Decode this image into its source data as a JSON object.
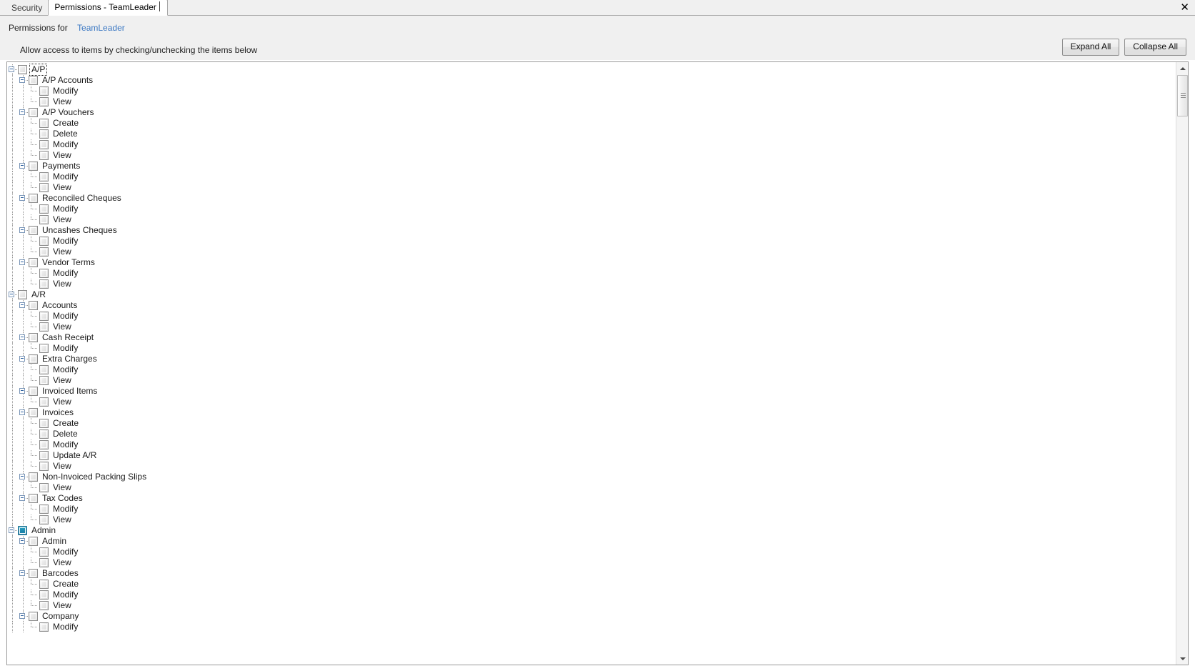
{
  "window": {
    "close_label": "✕"
  },
  "tabs": [
    {
      "label": "Security",
      "active": false
    },
    {
      "label": "Permissions - TeamLeader",
      "active": true
    }
  ],
  "header": {
    "permissions_for_label": "Permissions for",
    "role_name": "TeamLeader",
    "instruction": "Allow access to items by checking/unchecking the items below",
    "expand_all_label": "Expand All",
    "collapse_all_label": "Collapse All"
  },
  "colors": {
    "link": "#3b78c3",
    "checkbox_hot": "#1d87ad",
    "panel_bg": "#f0f0f0",
    "tree_bg": "#ffffff"
  },
  "scrollbar": {
    "up_icon": "triangle-up-icon",
    "down_icon": "triangle-down-icon",
    "thumb_icon": "scroll-thumb"
  },
  "tree": {
    "nodes": [
      {
        "label": "A/P",
        "depth": 0,
        "expander": true,
        "checkbox": "unchecked",
        "focused": true
      },
      {
        "label": "A/P Accounts",
        "depth": 1,
        "expander": true,
        "checkbox": "unchecked"
      },
      {
        "label": "Modify",
        "depth": 2,
        "expander": false,
        "checkbox": "unchecked"
      },
      {
        "label": "View",
        "depth": 2,
        "expander": false,
        "checkbox": "unchecked",
        "last": true
      },
      {
        "label": "A/P Vouchers",
        "depth": 1,
        "expander": true,
        "checkbox": "unchecked"
      },
      {
        "label": "Create",
        "depth": 2,
        "expander": false,
        "checkbox": "unchecked"
      },
      {
        "label": "Delete",
        "depth": 2,
        "expander": false,
        "checkbox": "unchecked"
      },
      {
        "label": "Modify",
        "depth": 2,
        "expander": false,
        "checkbox": "unchecked"
      },
      {
        "label": "View",
        "depth": 2,
        "expander": false,
        "checkbox": "unchecked",
        "last": true
      },
      {
        "label": "Payments",
        "depth": 1,
        "expander": true,
        "checkbox": "unchecked"
      },
      {
        "label": "Modify",
        "depth": 2,
        "expander": false,
        "checkbox": "unchecked"
      },
      {
        "label": "View",
        "depth": 2,
        "expander": false,
        "checkbox": "unchecked",
        "last": true
      },
      {
        "label": "Reconciled Cheques",
        "depth": 1,
        "expander": true,
        "checkbox": "unchecked"
      },
      {
        "label": "Modify",
        "depth": 2,
        "expander": false,
        "checkbox": "unchecked"
      },
      {
        "label": "View",
        "depth": 2,
        "expander": false,
        "checkbox": "unchecked",
        "last": true
      },
      {
        "label": "Uncashes Cheques",
        "depth": 1,
        "expander": true,
        "checkbox": "unchecked"
      },
      {
        "label": "Modify",
        "depth": 2,
        "expander": false,
        "checkbox": "unchecked"
      },
      {
        "label": "View",
        "depth": 2,
        "expander": false,
        "checkbox": "unchecked",
        "last": true
      },
      {
        "label": "Vendor Terms",
        "depth": 1,
        "expander": true,
        "checkbox": "unchecked",
        "last": true
      },
      {
        "label": "Modify",
        "depth": 2,
        "expander": false,
        "checkbox": "unchecked"
      },
      {
        "label": "View",
        "depth": 2,
        "expander": false,
        "checkbox": "unchecked",
        "last": true
      },
      {
        "label": "A/R",
        "depth": 0,
        "expander": true,
        "checkbox": "unchecked"
      },
      {
        "label": "Accounts",
        "depth": 1,
        "expander": true,
        "checkbox": "unchecked"
      },
      {
        "label": "Modify",
        "depth": 2,
        "expander": false,
        "checkbox": "unchecked"
      },
      {
        "label": "View",
        "depth": 2,
        "expander": false,
        "checkbox": "unchecked",
        "last": true
      },
      {
        "label": "Cash Receipt",
        "depth": 1,
        "expander": true,
        "checkbox": "unchecked"
      },
      {
        "label": "Modify",
        "depth": 2,
        "expander": false,
        "checkbox": "unchecked",
        "last": true
      },
      {
        "label": "Extra Charges",
        "depth": 1,
        "expander": true,
        "checkbox": "unchecked"
      },
      {
        "label": "Modify",
        "depth": 2,
        "expander": false,
        "checkbox": "unchecked"
      },
      {
        "label": "View",
        "depth": 2,
        "expander": false,
        "checkbox": "unchecked",
        "last": true
      },
      {
        "label": "Invoiced Items",
        "depth": 1,
        "expander": true,
        "checkbox": "unchecked"
      },
      {
        "label": "View",
        "depth": 2,
        "expander": false,
        "checkbox": "unchecked",
        "last": true
      },
      {
        "label": "Invoices",
        "depth": 1,
        "expander": true,
        "checkbox": "unchecked"
      },
      {
        "label": "Create",
        "depth": 2,
        "expander": false,
        "checkbox": "unchecked"
      },
      {
        "label": "Delete",
        "depth": 2,
        "expander": false,
        "checkbox": "unchecked"
      },
      {
        "label": "Modify",
        "depth": 2,
        "expander": false,
        "checkbox": "unchecked"
      },
      {
        "label": "Update A/R",
        "depth": 2,
        "expander": false,
        "checkbox": "unchecked"
      },
      {
        "label": "View",
        "depth": 2,
        "expander": false,
        "checkbox": "unchecked",
        "last": true
      },
      {
        "label": "Non-Invoiced Packing Slips",
        "depth": 1,
        "expander": true,
        "checkbox": "unchecked"
      },
      {
        "label": "View",
        "depth": 2,
        "expander": false,
        "checkbox": "unchecked",
        "last": true
      },
      {
        "label": "Tax Codes",
        "depth": 1,
        "expander": true,
        "checkbox": "unchecked",
        "last": true
      },
      {
        "label": "Modify",
        "depth": 2,
        "expander": false,
        "checkbox": "unchecked"
      },
      {
        "label": "View",
        "depth": 2,
        "expander": false,
        "checkbox": "unchecked",
        "last": true
      },
      {
        "label": "Admin",
        "depth": 0,
        "expander": true,
        "checkbox": "hot"
      },
      {
        "label": "Admin",
        "depth": 1,
        "expander": true,
        "checkbox": "unchecked"
      },
      {
        "label": "Modify",
        "depth": 2,
        "expander": false,
        "checkbox": "unchecked"
      },
      {
        "label": "View",
        "depth": 2,
        "expander": false,
        "checkbox": "unchecked",
        "last": true
      },
      {
        "label": "Barcodes",
        "depth": 1,
        "expander": true,
        "checkbox": "unchecked"
      },
      {
        "label": "Create",
        "depth": 2,
        "expander": false,
        "checkbox": "unchecked"
      },
      {
        "label": "Modify",
        "depth": 2,
        "expander": false,
        "checkbox": "unchecked"
      },
      {
        "label": "View",
        "depth": 2,
        "expander": false,
        "checkbox": "unchecked",
        "last": true
      },
      {
        "label": "Company",
        "depth": 1,
        "expander": true,
        "checkbox": "unchecked"
      },
      {
        "label": "Modify",
        "depth": 2,
        "expander": false,
        "checkbox": "unchecked"
      }
    ]
  }
}
